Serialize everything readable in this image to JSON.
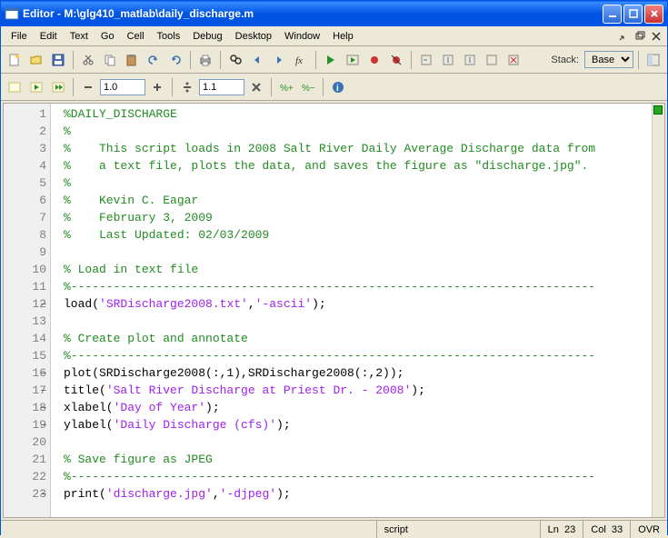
{
  "window": {
    "title": "Editor - M:\\glg410_matlab\\daily_discharge.m"
  },
  "menu": {
    "items": [
      "File",
      "Edit",
      "Text",
      "Go",
      "Cell",
      "Tools",
      "Debug",
      "Desktop",
      "Window",
      "Help"
    ]
  },
  "toolbar2": {
    "zoom1": "1.0",
    "zoom2": "1.1",
    "stack_label": "Stack:",
    "stack_value": "Base"
  },
  "status": {
    "type": "script",
    "line_label": "Ln",
    "line": "23",
    "col_label": "Col",
    "col": "33",
    "mode": "OVR"
  },
  "code": {
    "lines": [
      {
        "n": 1,
        "dash": false,
        "segments": [
          {
            "cls": "c-comment",
            "t": "%DAILY_DISCHARGE"
          }
        ]
      },
      {
        "n": 2,
        "dash": false,
        "segments": [
          {
            "cls": "c-comment",
            "t": "%"
          }
        ]
      },
      {
        "n": 3,
        "dash": false,
        "segments": [
          {
            "cls": "c-comment",
            "t": "%    This script loads in 2008 Salt River Daily Average Discharge data from"
          }
        ]
      },
      {
        "n": 4,
        "dash": false,
        "segments": [
          {
            "cls": "c-comment",
            "t": "%    a text file, plots the data, and saves the figure as \"discharge.jpg\"."
          }
        ]
      },
      {
        "n": 5,
        "dash": false,
        "segments": [
          {
            "cls": "c-comment",
            "t": "%"
          }
        ]
      },
      {
        "n": 6,
        "dash": false,
        "segments": [
          {
            "cls": "c-comment",
            "t": "%    Kevin C. Eagar"
          }
        ]
      },
      {
        "n": 7,
        "dash": false,
        "segments": [
          {
            "cls": "c-comment",
            "t": "%    February 3, 2009"
          }
        ]
      },
      {
        "n": 8,
        "dash": false,
        "segments": [
          {
            "cls": "c-comment",
            "t": "%    Last Updated: 02/03/2009"
          }
        ]
      },
      {
        "n": 9,
        "dash": false,
        "segments": []
      },
      {
        "n": 10,
        "dash": false,
        "segments": [
          {
            "cls": "c-comment",
            "t": "% Load in text file"
          }
        ]
      },
      {
        "n": 11,
        "dash": false,
        "segments": [
          {
            "cls": "c-comment",
            "t": "%--------------------------------------------------------------------------"
          }
        ]
      },
      {
        "n": 12,
        "dash": true,
        "segments": [
          {
            "cls": "",
            "t": "load("
          },
          {
            "cls": "c-string",
            "t": "'SRDischarge2008.txt'"
          },
          {
            "cls": "",
            "t": ","
          },
          {
            "cls": "c-string",
            "t": "'-ascii'"
          },
          {
            "cls": "",
            "t": ");"
          }
        ]
      },
      {
        "n": 13,
        "dash": false,
        "segments": []
      },
      {
        "n": 14,
        "dash": false,
        "segments": [
          {
            "cls": "c-comment",
            "t": "% Create plot and annotate"
          }
        ]
      },
      {
        "n": 15,
        "dash": false,
        "segments": [
          {
            "cls": "c-comment",
            "t": "%--------------------------------------------------------------------------"
          }
        ]
      },
      {
        "n": 16,
        "dash": true,
        "segments": [
          {
            "cls": "",
            "t": "plot(SRDischarge2008(:,1),SRDischarge2008(:,2));"
          }
        ]
      },
      {
        "n": 17,
        "dash": true,
        "segments": [
          {
            "cls": "",
            "t": "title("
          },
          {
            "cls": "c-string",
            "t": "'Salt River Discharge at Priest Dr. - 2008'"
          },
          {
            "cls": "",
            "t": ");"
          }
        ]
      },
      {
        "n": 18,
        "dash": true,
        "segments": [
          {
            "cls": "",
            "t": "xlabel("
          },
          {
            "cls": "c-string",
            "t": "'Day of Year'"
          },
          {
            "cls": "",
            "t": ");"
          }
        ]
      },
      {
        "n": 19,
        "dash": true,
        "segments": [
          {
            "cls": "",
            "t": "ylabel("
          },
          {
            "cls": "c-string",
            "t": "'Daily Discharge (cfs)'"
          },
          {
            "cls": "",
            "t": ");"
          }
        ]
      },
      {
        "n": 20,
        "dash": false,
        "segments": []
      },
      {
        "n": 21,
        "dash": false,
        "segments": [
          {
            "cls": "c-comment",
            "t": "% Save figure as JPEG"
          }
        ]
      },
      {
        "n": 22,
        "dash": false,
        "segments": [
          {
            "cls": "c-comment",
            "t": "%--------------------------------------------------------------------------"
          }
        ]
      },
      {
        "n": 23,
        "dash": true,
        "segments": [
          {
            "cls": "",
            "t": "print("
          },
          {
            "cls": "c-string",
            "t": "'discharge.jpg'"
          },
          {
            "cls": "",
            "t": ","
          },
          {
            "cls": "c-string",
            "t": "'-djpeg'"
          },
          {
            "cls": "",
            "t": ");"
          }
        ]
      }
    ]
  }
}
